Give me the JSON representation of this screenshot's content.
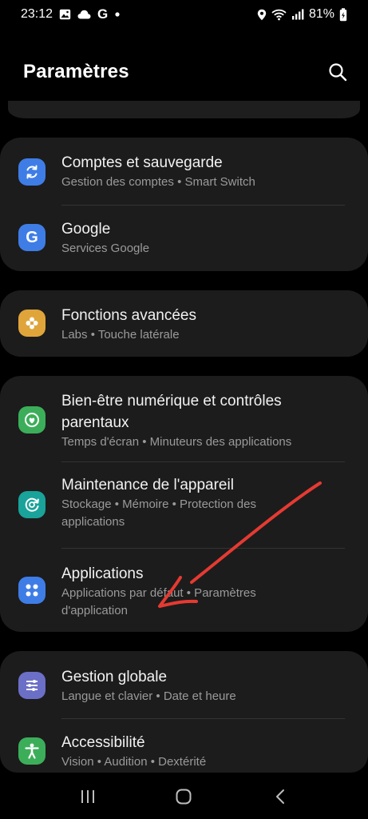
{
  "status_bar": {
    "time": "23:12",
    "battery": "81%",
    "left_icons": [
      "gallery-icon",
      "cloud-icon",
      "google-icon",
      "dot-icon"
    ],
    "right_icons": [
      "location-icon",
      "wifi-icon",
      "signal-icon",
      "battery-icon"
    ]
  },
  "header": {
    "title": "Paramètres",
    "search_icon": "search-icon"
  },
  "groups": [
    {
      "items": [
        {
          "title": "Comptes et sauvegarde",
          "subtitle": "Gestion des comptes  •  Smart Switch",
          "icon": "sync-icon",
          "color": "#3f7de6"
        },
        {
          "title": "Google",
          "subtitle": "Services Google",
          "icon": "google-icon",
          "color": "#3f7de6"
        }
      ]
    },
    {
      "items": [
        {
          "title": "Fonctions avancées",
          "subtitle": "Labs  •  Touche latérale",
          "icon": "puzzle-icon",
          "color": "#e0a53a"
        }
      ]
    },
    {
      "items": [
        {
          "title": "Bien-être numérique et contrôles",
          "title2": "parentaux",
          "subtitle": "Temps d'écran  •  Minuteurs des applications",
          "icon": "wellbeing-icon",
          "color": "#3cae5a"
        },
        {
          "title": "Maintenance de l'appareil",
          "subtitle": "Stockage  •  Mémoire  •  Protection des",
          "subtitle2": "applications",
          "icon": "maintenance-icon",
          "color": "#19a39a"
        },
        {
          "title": "Applications",
          "subtitle": "Applications par défaut  •  Paramètres",
          "subtitle2": "d'application",
          "icon": "apps-icon",
          "color": "#3f7de6"
        }
      ]
    },
    {
      "items": [
        {
          "title": "Gestion globale",
          "subtitle": "Langue et clavier  •  Date et heure",
          "icon": "sliders-icon",
          "color": "#6b6fc6"
        },
        {
          "title": "Accessibilité",
          "subtitle": "Vision  •  Audition  •  Dextérité",
          "icon": "accessibility-icon",
          "color": "#3cae5a"
        }
      ]
    }
  ],
  "nav_bar": {
    "recents_icon": "recents-icon",
    "home_icon": "home-icon",
    "back_icon": "back-icon"
  },
  "annotation": {
    "arrow_color": "#e53a32"
  }
}
